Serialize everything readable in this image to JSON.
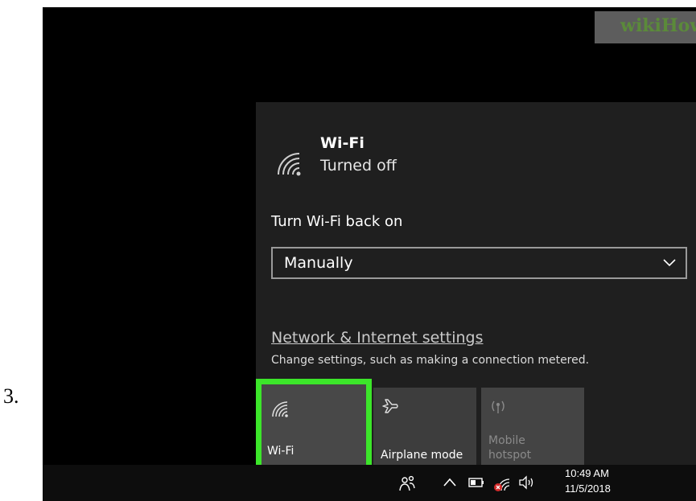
{
  "step_number": "3.",
  "wifi": {
    "name": "Wi-Fi",
    "status": "Turned off"
  },
  "turn_back_on": {
    "label": "Turn Wi-Fi back on",
    "selected": "Manually"
  },
  "network": {
    "link": "Network & Internet settings",
    "description": "Change settings, such as making a connection metered."
  },
  "quick_actions": [
    {
      "label": "Wi-Fi",
      "icon": "wifi-icon",
      "highlighted": true
    },
    {
      "label": "Airplane mode",
      "icon": "airplane-icon"
    },
    {
      "label": "Mobile hotspot",
      "icon": "hotspot-icon",
      "disabled": true
    }
  ],
  "taskbar": {
    "time": "10:49 AM",
    "date": "11/5/2018"
  },
  "watermark": "wikiHow",
  "colors": {
    "highlight": "#3ce62a",
    "flyout_bg": "#1f1f1f",
    "tile_bg": "#3d3d3d"
  }
}
